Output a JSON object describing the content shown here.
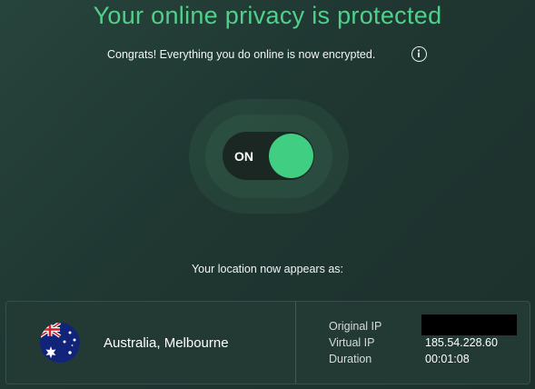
{
  "status": {
    "headline": "Your online privacy is protected",
    "subline": "Congrats! Everything you do online is now encrypted.",
    "info_icon": "info-circle-icon"
  },
  "toggle": {
    "label": "ON",
    "state": "on",
    "accent_color": "#3fce82"
  },
  "location": {
    "label": "Your location now appears as:",
    "country": "Australia",
    "flag_icon": "australia-flag-icon",
    "name": "Australia, Melbourne"
  },
  "connection": {
    "original_ip_label": "Original IP",
    "original_ip_value": "",
    "original_ip_redacted": true,
    "virtual_ip_label": "Virtual IP",
    "virtual_ip_value": "185.54.228.60",
    "duration_label": "Duration",
    "duration_value": "00:01:08"
  },
  "colors": {
    "headline": "#4fd18b",
    "background": "#223b35",
    "toggle_track": "#1a2723"
  }
}
